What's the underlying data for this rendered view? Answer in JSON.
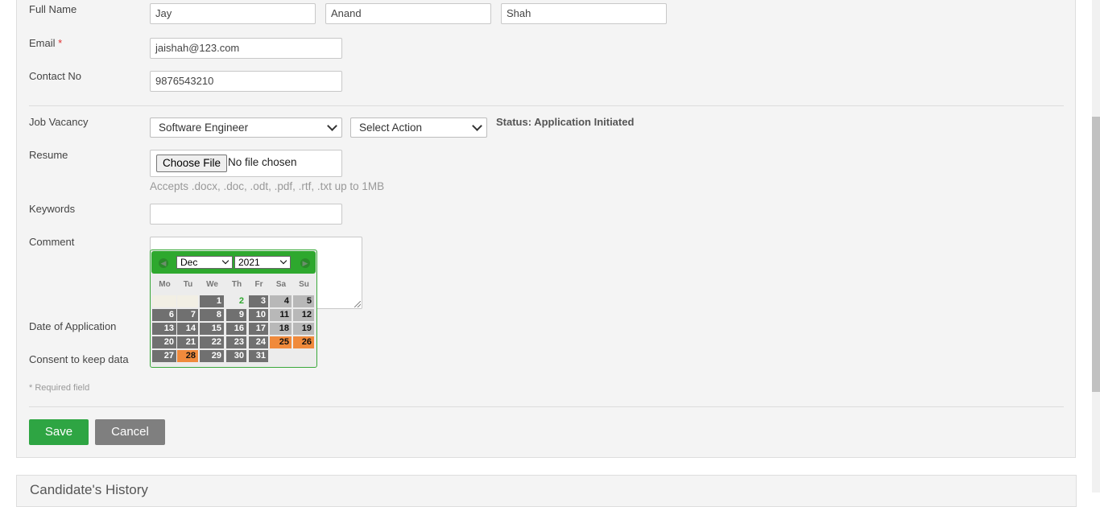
{
  "form": {
    "full_name": {
      "label": "Full Name",
      "first": "Jay",
      "middle": "Anand",
      "last": "Shah"
    },
    "email": {
      "label": "Email",
      "required_mark": "*",
      "value": "jaishah@123.com"
    },
    "contact": {
      "label": "Contact No",
      "value": "9876543210"
    },
    "vacancy": {
      "label": "Job Vacancy",
      "selected": "Software Engineer",
      "action_selected": "Select Action",
      "status": "Status: Application Initiated"
    },
    "resume": {
      "label": "Resume",
      "choose_label": "Choose File",
      "no_file": "No file chosen",
      "hint": "Accepts .docx, .doc, .odt, .pdf, .rtf, .txt up to 1MB"
    },
    "keywords": {
      "label": "Keywords",
      "value": ""
    },
    "comment": {
      "label": "Comment",
      "value": ""
    },
    "date_of_application": {
      "label": "Date of Application"
    },
    "consent": {
      "label": "Consent to keep data"
    },
    "required_note": "* Required field",
    "save_label": "Save",
    "cancel_label": "Cancel"
  },
  "calendar": {
    "month": "Dec",
    "year": "2021",
    "weekdays": [
      "Mo",
      "Tu",
      "We",
      "Th",
      "Fr",
      "Sa",
      "Su"
    ],
    "first_weekday_index": 2,
    "days_in_month": 31,
    "today": 2,
    "holidays": [
      25,
      26,
      28
    ],
    "colors": {
      "header": "#2ea82e",
      "weekday": "#707070",
      "weekend": "#b8b8b8",
      "holiday": "#f08a3c"
    }
  },
  "history": {
    "title": "Candidate's History"
  }
}
